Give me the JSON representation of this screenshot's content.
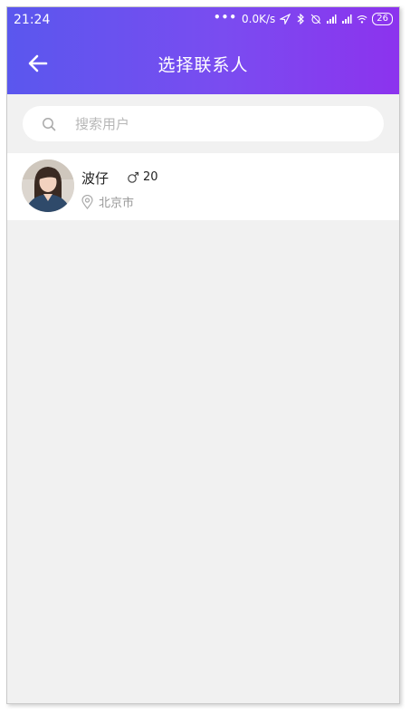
{
  "status_bar": {
    "time": "21:24",
    "speed": "0.0K/s",
    "battery": "26"
  },
  "header": {
    "title": "选择联系人"
  },
  "search": {
    "placeholder": "搜索用户"
  },
  "contacts": [
    {
      "name": "波仔",
      "age": "20",
      "city": "北京市"
    }
  ],
  "colors": {
    "gradient_start": "#5a57ee",
    "gradient_end": "#8c33ee",
    "background": "#f1f1f1"
  }
}
